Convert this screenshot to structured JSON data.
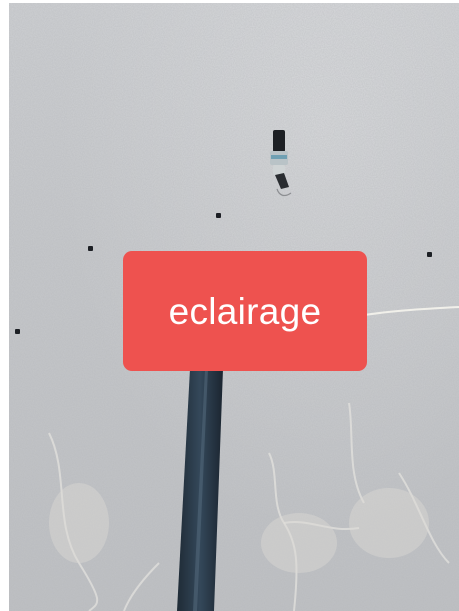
{
  "label": {
    "text": "eclairage",
    "background_color": "#ee524f",
    "text_color": "#ffffff"
  }
}
